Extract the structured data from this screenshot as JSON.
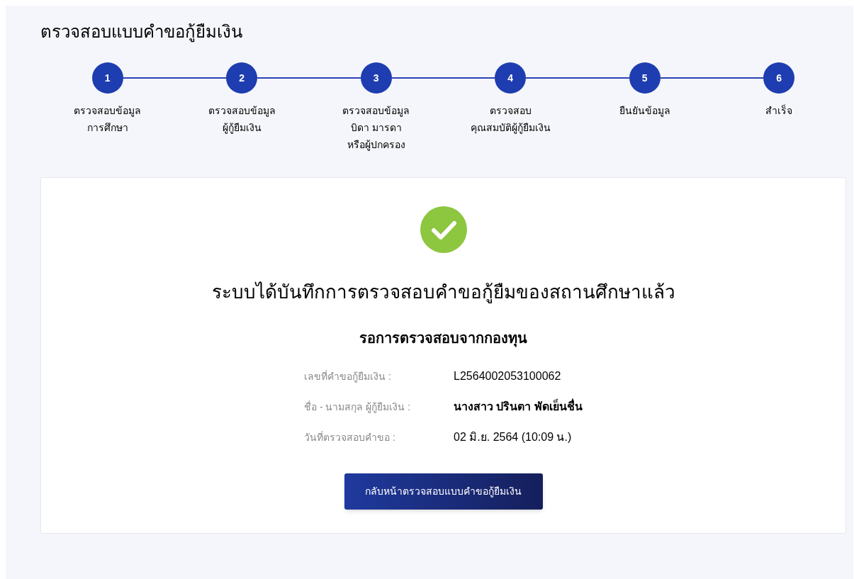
{
  "title": "ตรวจสอบแบบคำขอกู้ยืมเงิน",
  "steps": [
    {
      "number": "1",
      "lines": [
        "ตรวจสอบข้อมูล",
        "การศึกษา"
      ]
    },
    {
      "number": "2",
      "lines": [
        "ตรวจสอบข้อมูล",
        "ผู้กู้ยืมเงิน"
      ]
    },
    {
      "number": "3",
      "lines": [
        "ตรวจสอบข้อมูล",
        "บิดา มารดา",
        "หรือผู้ปกครอง"
      ]
    },
    {
      "number": "4",
      "lines": [
        "ตรวจสอบ",
        "คุณสมบัติผู้กู้ยืมเงิน"
      ]
    },
    {
      "number": "5",
      "lines": [
        "ยืนยันข้อมูล"
      ]
    },
    {
      "number": "6",
      "lines": [
        "สำเร็จ"
      ]
    }
  ],
  "result": {
    "heading": "ระบบได้บันทึกการตรวจสอบคำขอกู้ยืมของสถานศึกษาแล้ว",
    "subheading": "รอการตรวจสอบจากกองทุน",
    "details": [
      {
        "label": "เลขที่คำขอกู้ยืมเงิน :",
        "value": "L2564002053100062",
        "bold": false
      },
      {
        "label": "ชื่อ - นามสกุล ผู้กู้ยืมเงิน :",
        "value": "นางสาว ปรินตา พัดเย็นชื่น",
        "bold": true
      },
      {
        "label": "วันที่ตรวจสอบคำขอ :",
        "value": "02 มิ.ย. 2564 (10:09 น.)",
        "bold": false
      }
    ],
    "button": "กลับหน้าตรวจสอบแบบคำขอกู้ยืมเงิน"
  }
}
